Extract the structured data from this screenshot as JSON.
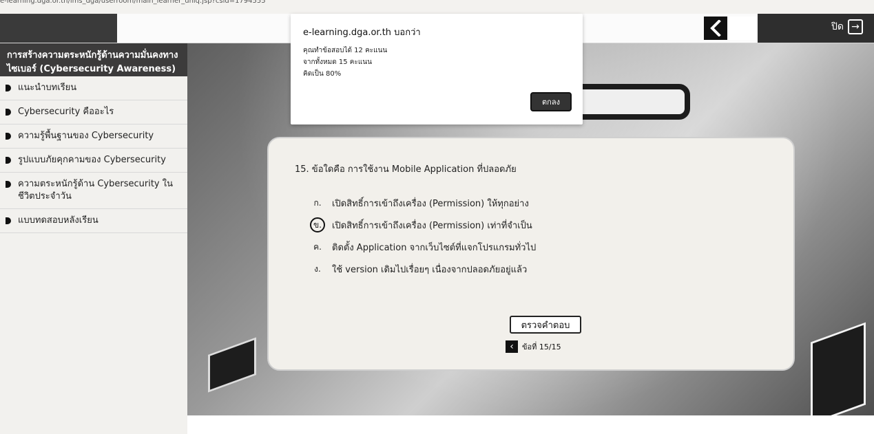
{
  "browser": {
    "url": "e-learning.dga.or.th/lms_dga/userroom/main_learner_uniq.jsp?csid=1794555"
  },
  "topbar": {
    "close_label": "ปิด",
    "back_icon": "chevron-left-icon",
    "close_icon": "exit-icon"
  },
  "sidebar": {
    "course_title_line1": "การสร้างความตระหนักรู้ด้านความมั่นคงทาง",
    "course_title_line2": "ไซเบอร์ (Cybersecurity Awareness)",
    "items": [
      {
        "label": "แนะนำบทเรียน"
      },
      {
        "label": "Cybersecurity คืออะไร"
      },
      {
        "label": "ความรู้พื้นฐานของ Cybersecurity"
      },
      {
        "label": "รูปแบบภัยคุกคามของ Cybersecurity"
      },
      {
        "label": "ความตระหนักรู้ด้าน Cybersecurity ในชีวิตประจำวัน"
      },
      {
        "label": "แบบทดสอบหลังเรียน"
      }
    ]
  },
  "dialog": {
    "host": "e-learning.dga.or.th บอกว่า",
    "line1": "คุณทำข้อสอบได้ 12 คะแนน",
    "line2": "จากทั้งหมด 15 คะแนน",
    "line3": "คิดเป็น 80%",
    "ok_label": "ตกลง"
  },
  "question": {
    "text": "15. ข้อใดคือ การใช้งาน Mobile Application ที่ปลอดภัย",
    "choices": [
      {
        "letter": "ก.",
        "text": "เปิดสิทธิ์การเข้าถึงเครื่อง (Permission) ให้ทุกอย่าง",
        "selected": false
      },
      {
        "letter": "ข.",
        "text": "เปิดสิทธิ์การเข้าถึงเครื่อง (Permission) เท่าที่จำเป็น",
        "selected": true
      },
      {
        "letter": "ค.",
        "text": "ติดตั้ง Application จากเว็บไซต์ที่แจกโปรแกรมทั่วไป",
        "selected": false
      },
      {
        "letter": "ง.",
        "text": "ใช้ version เดิมไปเรื่อยๆ เนื่องจากปลอดภัยอยู่แล้ว",
        "selected": false
      }
    ],
    "check_label": "ตรวจคำตอบ",
    "counter": "ข้อที่ 15/15"
  }
}
